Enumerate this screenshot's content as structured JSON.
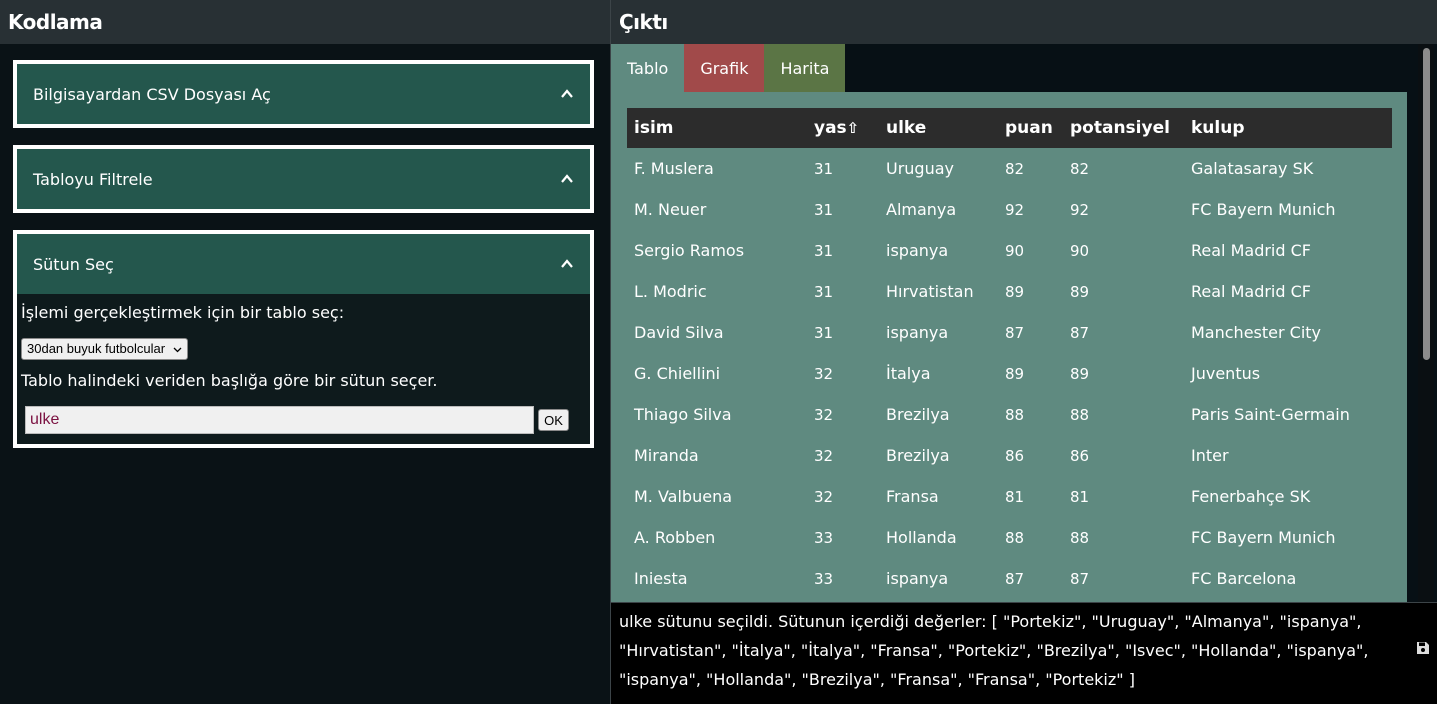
{
  "left": {
    "title": "Kodlama",
    "sections": [
      {
        "title": "Bilgisayardan CSV Dosyası Aç"
      },
      {
        "title": "Tabloyu Filtrele"
      },
      {
        "title": "Sütun Seç"
      }
    ],
    "column_select": {
      "prompt": "İşlemi gerçekleştirmek için bir tablo seç:",
      "table_select_value": "30dan buyuk futbolcular",
      "instruction": "Tablo halindeki veriden başlığa göre bir sütun seçer.",
      "column_input_value": "ulke",
      "ok_label": "OK"
    }
  },
  "right": {
    "title": "Çıktı",
    "tabs": [
      {
        "label": "Tablo",
        "color": "#5f8a80"
      },
      {
        "label": "Grafik",
        "color": "#a14a4a"
      },
      {
        "label": "Harita",
        "color": "#5b7545"
      }
    ],
    "table": {
      "headers": [
        "isim",
        "yas",
        "ulke",
        "puan",
        "potansiyel",
        "kulup"
      ],
      "sort_indicator": "⇧",
      "rows": [
        [
          "F. Muslera",
          "31",
          "Uruguay",
          "82",
          "82",
          "Galatasaray SK"
        ],
        [
          "M. Neuer",
          "31",
          "Almanya",
          "92",
          "92",
          "FC Bayern Munich"
        ],
        [
          "Sergio Ramos",
          "31",
          "ispanya",
          "90",
          "90",
          "Real Madrid CF"
        ],
        [
          "L. Modric",
          "31",
          "Hırvatistan",
          "89",
          "89",
          "Real Madrid CF"
        ],
        [
          "David Silva",
          "31",
          "ispanya",
          "87",
          "87",
          "Manchester City"
        ],
        [
          "G. Chiellini",
          "32",
          "İtalya",
          "89",
          "89",
          "Juventus"
        ],
        [
          "Thiago Silva",
          "32",
          "Brezilya",
          "88",
          "88",
          "Paris Saint-Germain"
        ],
        [
          "Miranda",
          "32",
          "Brezilya",
          "86",
          "86",
          "Inter"
        ],
        [
          "M. Valbuena",
          "32",
          "Fransa",
          "81",
          "81",
          "Fenerbahçe SK"
        ],
        [
          "A. Robben",
          "33",
          "Hollanda",
          "88",
          "88",
          "FC Bayern Munich"
        ],
        [
          "Iniesta",
          "33",
          "ispanya",
          "87",
          "87",
          "FC Barcelona"
        ]
      ]
    },
    "status_text": "ulke sütunu seçildi. Sütunun içerdiği değerler: [ \"Portekiz\", \"Uruguay\", \"Almanya\", \"ispanya\", \"Hırvatistan\", \"İtalya\", \"İtalya\", \"Fransa\", \"Portekiz\", \"Brezilya\", \"Isvec\", \"Hollanda\", \"ispanya\", \"ispanya\", \"Hollanda\", \"Brezilya\", \"Fransa\", \"Fransa\", \"Portekiz\" ]"
  }
}
